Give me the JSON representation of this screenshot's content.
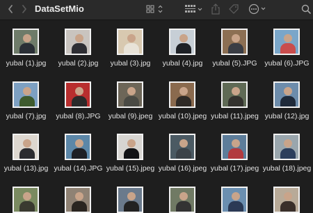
{
  "window": {
    "title": "DataSetMio",
    "back_icon": "chevron-left-icon",
    "forward_icon": "chevron-right-icon"
  },
  "toolbar": {
    "view_icon": "grid-view-icon",
    "group_icon": "group-by-icon",
    "share_icon": "share-icon",
    "tag_icon": "tag-icon",
    "more_icon": "ellipsis-icon",
    "search_icon": "search-icon"
  },
  "files": [
    {
      "name": "yubal (1).jpg",
      "bg": "#6e7b69",
      "shirt": "#2a2f36"
    },
    {
      "name": "yubal (2).jpg",
      "bg": "#c9c4bf",
      "shirt": "#2e2e33"
    },
    {
      "name": "yubal (3).jpg",
      "bg": "#d8c9b0",
      "shirt": "#e8e3d8"
    },
    {
      "name": "yubal (4).jpg",
      "bg": "#c7cfd6",
      "shirt": "#1e2126"
    },
    {
      "name": "yubal (5).JPG",
      "bg": "#8c6f53",
      "shirt": "#3a3d44"
    },
    {
      "name": "yubal (6).JPG",
      "bg": "#7aa6c9",
      "shirt": "#c94d4d"
    },
    {
      "name": "yubal (7).jpg",
      "bg": "#7da0c2",
      "shirt": "#3e5b2e"
    },
    {
      "name": "yubal (8).JPG",
      "bg": "#b82e2e",
      "shirt": "#2a2a2a"
    },
    {
      "name": "yubal (9).jpeg",
      "bg": "#6d6658",
      "shirt": "#4a4a44"
    },
    {
      "name": "yubal (10).jpeg",
      "bg": "#8a6a4e",
      "shirt": "#2f2a26"
    },
    {
      "name": "yubal (11).jpeg",
      "bg": "#5f6a55",
      "shirt": "#33322e"
    },
    {
      "name": "yubal (12).jpg",
      "bg": "#6d8cab",
      "shirt": "#1f2a3a"
    },
    {
      "name": "yubal (13).jpg",
      "bg": "#ddd7cf",
      "shirt": "#2b2b2f"
    },
    {
      "name": "yubal (14).JPG",
      "bg": "#5c87a8",
      "shirt": "#1e1f24"
    },
    {
      "name": "yubal (15).jpeg",
      "bg": "#d7d5d1",
      "shirt": "#121316"
    },
    {
      "name": "yubal (16).jpeg",
      "bg": "#4b5a63",
      "shirt": "#3b4248"
    },
    {
      "name": "yubal (17).jpeg",
      "bg": "#5d7d9a",
      "shirt": "#b23a3f"
    },
    {
      "name": "yubal (18).jpeg",
      "bg": "#9aa6ad",
      "shirt": "#2c3e5c"
    },
    {
      "name": "",
      "bg": "#7a8a60",
      "shirt": "#3a3a30"
    },
    {
      "name": "",
      "bg": "#8f8274",
      "shirt": "#2a2520"
    },
    {
      "name": "",
      "bg": "#6a7a8c",
      "shirt": "#222"
    },
    {
      "name": "",
      "bg": "#707a64",
      "shirt": "#333"
    },
    {
      "name": "",
      "bg": "#6b8fb0",
      "shirt": "#2b3a55"
    },
    {
      "name": "",
      "bg": "#b8aa98",
      "shirt": "#3a2f2a"
    }
  ],
  "colors": {
    "window_bg": "#1e1e1e",
    "toolbar_bg": "#2a2a2a",
    "text": "#e2e2e2",
    "icon": "#a8a8a8"
  }
}
